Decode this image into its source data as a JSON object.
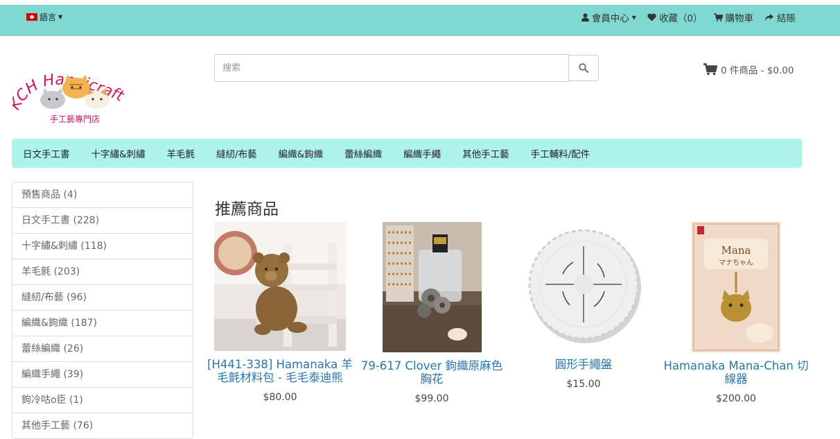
{
  "topbar": {
    "language_label": "語言",
    "links": [
      {
        "label": "會員中心",
        "icon": "user-icon",
        "dropdown": true
      },
      {
        "label": "收藏（0）",
        "icon": "heart-icon"
      },
      {
        "label": "購物車",
        "icon": "shopping-cart-icon"
      },
      {
        "label": "結賬",
        "icon": "share-icon"
      }
    ]
  },
  "logo": {
    "text": "KCH Handicraft",
    "subtext": "手工藝專門店"
  },
  "search": {
    "placeholder": "搜索",
    "value": ""
  },
  "cart": {
    "summary": "0 件商品 - $0.00"
  },
  "main_nav": [
    "日文手工書",
    "十字繡&刺繡",
    "羊毛氈",
    "縫紉/布藝",
    "編織&鉤織",
    "蕾絲編織",
    "編織手繩",
    "其他手工藝",
    "手工輔料/配件"
  ],
  "sidebar": [
    "預售商品 (4)",
    "日文手工書 (228)",
    "十字繡&刺繡 (118)",
    "羊毛氈 (203)",
    "縫紉/布藝 (96)",
    "編織&鉤織 (187)",
    "蕾絲編織 (26)",
    "編織手繩 (39)",
    "鉤冷咕o臣 (1)",
    "其他手工藝 (76)"
  ],
  "featured": {
    "title": "推薦商品",
    "products": [
      {
        "name": "[H441-338] Hamanaka 羊毛氈材料包 - 毛毛泰迪熊",
        "price": "$80.00"
      },
      {
        "name": "79-617 Clover 鉤織原麻色胸花",
        "price": "$99.00"
      },
      {
        "name": "圓形手繩盤",
        "price": "$15.00"
      },
      {
        "name": "Hamanaka Mana-Chan 切線器",
        "price": "$200.00"
      }
    ]
  },
  "colors": {
    "topbar_bg": "#80d8d2",
    "nav_bg": "#aef2ec",
    "link": "#2a75b0",
    "logo_red": "#d4145a"
  }
}
